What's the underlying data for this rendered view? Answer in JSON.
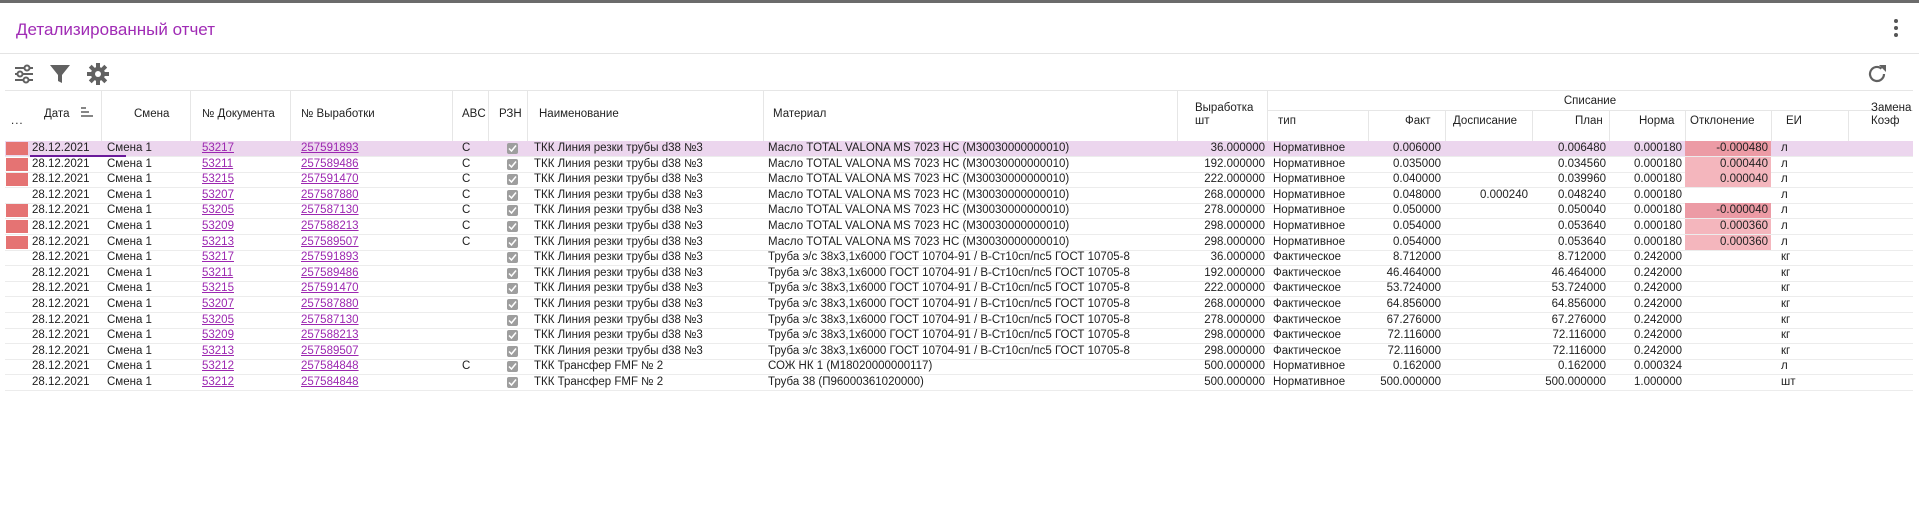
{
  "title": "Детализированный отчет",
  "colors": {
    "accent": "#a02bb5",
    "link": "#9c27b0",
    "marker": "#e57373",
    "deviation": "#f4b6bd",
    "selected_row": "#ecd6ee"
  },
  "toolbar": {
    "icons": [
      "sliders-icon",
      "filter-icon",
      "gear-icon"
    ],
    "right_icon": "refresh-icon"
  },
  "columns": {
    "more": "...",
    "date": "Дата",
    "shift": "Смена",
    "doc": "№ Документа",
    "output_no": "№ Выработки",
    "abc": "ABC",
    "rzn": "РЗН",
    "name": "Наименование",
    "material": "Материал",
    "output_qty_1": "Выработка",
    "output_qty_2": "шт",
    "writeoff_group": "Списание",
    "type": "тип",
    "fact": "Факт",
    "extra": "Досписание",
    "plan": "План",
    "norm": "Норма",
    "deviation": "Отклонение",
    "unit": "ЕИ",
    "replace_1": "Замена",
    "replace_2": "Коэф"
  },
  "rows": [
    {
      "marked": true,
      "selected": true,
      "date": "28.12.2021",
      "shift": "Смена 1",
      "doc": "53217",
      "output_no": "257591893",
      "abc": "C",
      "name": "ТКК Линия резки трубы d38 №3",
      "material": "Масло TOTAL VALONA MS 7023 HC (M30030000000010)",
      "qty": "36.000000",
      "type": "Нормативное",
      "fact": "0.006000",
      "extra": "",
      "plan": "0.006480",
      "norm": "0.000180",
      "deviation": "-0.000480",
      "dev_level": "hi",
      "unit": "л"
    },
    {
      "marked": true,
      "selected": false,
      "date": "28.12.2021",
      "shift": "Смена 1",
      "doc": "53211",
      "output_no": "257589486",
      "abc": "C",
      "name": "ТКК Линия резки трубы d38 №3",
      "material": "Масло TOTAL VALONA MS 7023 HC (M30030000000010)",
      "qty": "192.000000",
      "type": "Нормативное",
      "fact": "0.035000",
      "extra": "",
      "plan": "0.034560",
      "norm": "0.000180",
      "deviation": "0.000440",
      "dev_level": "lo",
      "unit": "л"
    },
    {
      "marked": true,
      "selected": false,
      "date": "28.12.2021",
      "shift": "Смена 1",
      "doc": "53215",
      "output_no": "257591470",
      "abc": "C",
      "name": "ТКК Линия резки трубы d38 №3",
      "material": "Масло TOTAL VALONA MS 7023 HC (M30030000000010)",
      "qty": "222.000000",
      "type": "Нормативное",
      "fact": "0.040000",
      "extra": "",
      "plan": "0.039960",
      "norm": "0.000180",
      "deviation": "0.000040",
      "dev_level": "lo",
      "unit": "л"
    },
    {
      "marked": false,
      "selected": false,
      "date": "28.12.2021",
      "shift": "Смена 1",
      "doc": "53207",
      "output_no": "257587880",
      "abc": "C",
      "name": "ТКК Линия резки трубы d38 №3",
      "material": "Масло TOTAL VALONA MS 7023 HC (M30030000000010)",
      "qty": "268.000000",
      "type": "Нормативное",
      "fact": "0.048000",
      "extra": "0.000240",
      "plan": "0.048240",
      "norm": "0.000180",
      "deviation": "",
      "dev_level": "",
      "unit": "л"
    },
    {
      "marked": true,
      "selected": false,
      "date": "28.12.2021",
      "shift": "Смена 1",
      "doc": "53205",
      "output_no": "257587130",
      "abc": "C",
      "name": "ТКК Линия резки трубы d38 №3",
      "material": "Масло TOTAL VALONA MS 7023 HC (M30030000000010)",
      "qty": "278.000000",
      "type": "Нормативное",
      "fact": "0.050000",
      "extra": "",
      "plan": "0.050040",
      "norm": "0.000180",
      "deviation": "-0.000040",
      "dev_level": "hi",
      "unit": "л"
    },
    {
      "marked": true,
      "selected": false,
      "date": "28.12.2021",
      "shift": "Смена 1",
      "doc": "53209",
      "output_no": "257588213",
      "abc": "C",
      "name": "ТКК Линия резки трубы d38 №3",
      "material": "Масло TOTAL VALONA MS 7023 HC (M30030000000010)",
      "qty": "298.000000",
      "type": "Нормативное",
      "fact": "0.054000",
      "extra": "",
      "plan": "0.053640",
      "norm": "0.000180",
      "deviation": "0.000360",
      "dev_level": "lo",
      "unit": "л"
    },
    {
      "marked": true,
      "selected": false,
      "date": "28.12.2021",
      "shift": "Смена 1",
      "doc": "53213",
      "output_no": "257589507",
      "abc": "C",
      "name": "ТКК Линия резки трубы d38 №3",
      "material": "Масло TOTAL VALONA MS 7023 HC (M30030000000010)",
      "qty": "298.000000",
      "type": "Нормативное",
      "fact": "0.054000",
      "extra": "",
      "plan": "0.053640",
      "norm": "0.000180",
      "deviation": "0.000360",
      "dev_level": "lo",
      "unit": "л"
    },
    {
      "marked": false,
      "selected": false,
      "date": "28.12.2021",
      "shift": "Смена 1",
      "doc": "53217",
      "output_no": "257591893",
      "abc": "",
      "name": "ТКК Линия резки трубы d38 №3",
      "material": "Труба э/с 38х3,1х6000 ГОСТ 10704-91 / В-Ст10сп/пс5 ГОСТ 10705-8",
      "qty": "36.000000",
      "type": "Фактическое",
      "fact": "8.712000",
      "extra": "",
      "plan": "8.712000",
      "norm": "0.242000",
      "deviation": "",
      "dev_level": "",
      "unit": "кг"
    },
    {
      "marked": false,
      "selected": false,
      "date": "28.12.2021",
      "shift": "Смена 1",
      "doc": "53211",
      "output_no": "257589486",
      "abc": "",
      "name": "ТКК Линия резки трубы d38 №3",
      "material": "Труба э/с 38х3,1х6000 ГОСТ 10704-91 / В-Ст10сп/пс5 ГОСТ 10705-8",
      "qty": "192.000000",
      "type": "Фактическое",
      "fact": "46.464000",
      "extra": "",
      "plan": "46.464000",
      "norm": "0.242000",
      "deviation": "",
      "dev_level": "",
      "unit": "кг"
    },
    {
      "marked": false,
      "selected": false,
      "date": "28.12.2021",
      "shift": "Смена 1",
      "doc": "53215",
      "output_no": "257591470",
      "abc": "",
      "name": "ТКК Линия резки трубы d38 №3",
      "material": "Труба э/с 38х3,1х6000 ГОСТ 10704-91 / В-Ст10сп/пс5 ГОСТ 10705-8",
      "qty": "222.000000",
      "type": "Фактическое",
      "fact": "53.724000",
      "extra": "",
      "plan": "53.724000",
      "norm": "0.242000",
      "deviation": "",
      "dev_level": "",
      "unit": "кг"
    },
    {
      "marked": false,
      "selected": false,
      "date": "28.12.2021",
      "shift": "Смена 1",
      "doc": "53207",
      "output_no": "257587880",
      "abc": "",
      "name": "ТКК Линия резки трубы d38 №3",
      "material": "Труба э/с 38х3,1х6000 ГОСТ 10704-91 / В-Ст10сп/пс5 ГОСТ 10705-8",
      "qty": "268.000000",
      "type": "Фактическое",
      "fact": "64.856000",
      "extra": "",
      "plan": "64.856000",
      "norm": "0.242000",
      "deviation": "",
      "dev_level": "",
      "unit": "кг"
    },
    {
      "marked": false,
      "selected": false,
      "date": "28.12.2021",
      "shift": "Смена 1",
      "doc": "53205",
      "output_no": "257587130",
      "abc": "",
      "name": "ТКК Линия резки трубы d38 №3",
      "material": "Труба э/с 38х3,1х6000 ГОСТ 10704-91 / В-Ст10сп/пс5 ГОСТ 10705-8",
      "qty": "278.000000",
      "type": "Фактическое",
      "fact": "67.276000",
      "extra": "",
      "plan": "67.276000",
      "norm": "0.242000",
      "deviation": "",
      "dev_level": "",
      "unit": "кг"
    },
    {
      "marked": false,
      "selected": false,
      "date": "28.12.2021",
      "shift": "Смена 1",
      "doc": "53209",
      "output_no": "257588213",
      "abc": "",
      "name": "ТКК Линия резки трубы d38 №3",
      "material": "Труба э/с 38х3,1х6000 ГОСТ 10704-91 / В-Ст10сп/пс5 ГОСТ 10705-8",
      "qty": "298.000000",
      "type": "Фактическое",
      "fact": "72.116000",
      "extra": "",
      "plan": "72.116000",
      "norm": "0.242000",
      "deviation": "",
      "dev_level": "",
      "unit": "кг"
    },
    {
      "marked": false,
      "selected": false,
      "date": "28.12.2021",
      "shift": "Смена 1",
      "doc": "53213",
      "output_no": "257589507",
      "abc": "",
      "name": "ТКК Линия резки трубы d38 №3",
      "material": "Труба э/с 38х3,1х6000 ГОСТ 10704-91 / В-Ст10сп/пс5 ГОСТ 10705-8",
      "qty": "298.000000",
      "type": "Фактическое",
      "fact": "72.116000",
      "extra": "",
      "plan": "72.116000",
      "norm": "0.242000",
      "deviation": "",
      "dev_level": "",
      "unit": "кг"
    },
    {
      "marked": false,
      "selected": false,
      "date": "28.12.2021",
      "shift": "Смена 1",
      "doc": "53212",
      "output_no": "257584848",
      "abc": "C",
      "name": "ТКК Трансфер FMF № 2",
      "material": "СОЖ НК 1 (M18020000000117)",
      "qty": "500.000000",
      "type": "Нормативное",
      "fact": "0.162000",
      "extra": "",
      "plan": "0.162000",
      "norm": "0.000324",
      "deviation": "",
      "dev_level": "",
      "unit": "л"
    },
    {
      "marked": false,
      "selected": false,
      "date": "28.12.2021",
      "shift": "Смена 1",
      "doc": "53212",
      "output_no": "257584848",
      "abc": "",
      "name": "ТКК Трансфер FMF № 2",
      "material": "Труба 38 (П96000361020000)",
      "qty": "500.000000",
      "type": "Нормативное",
      "fact": "500.000000",
      "extra": "",
      "plan": "500.000000",
      "norm": "1.000000",
      "deviation": "",
      "dev_level": "",
      "unit": "шт"
    }
  ]
}
